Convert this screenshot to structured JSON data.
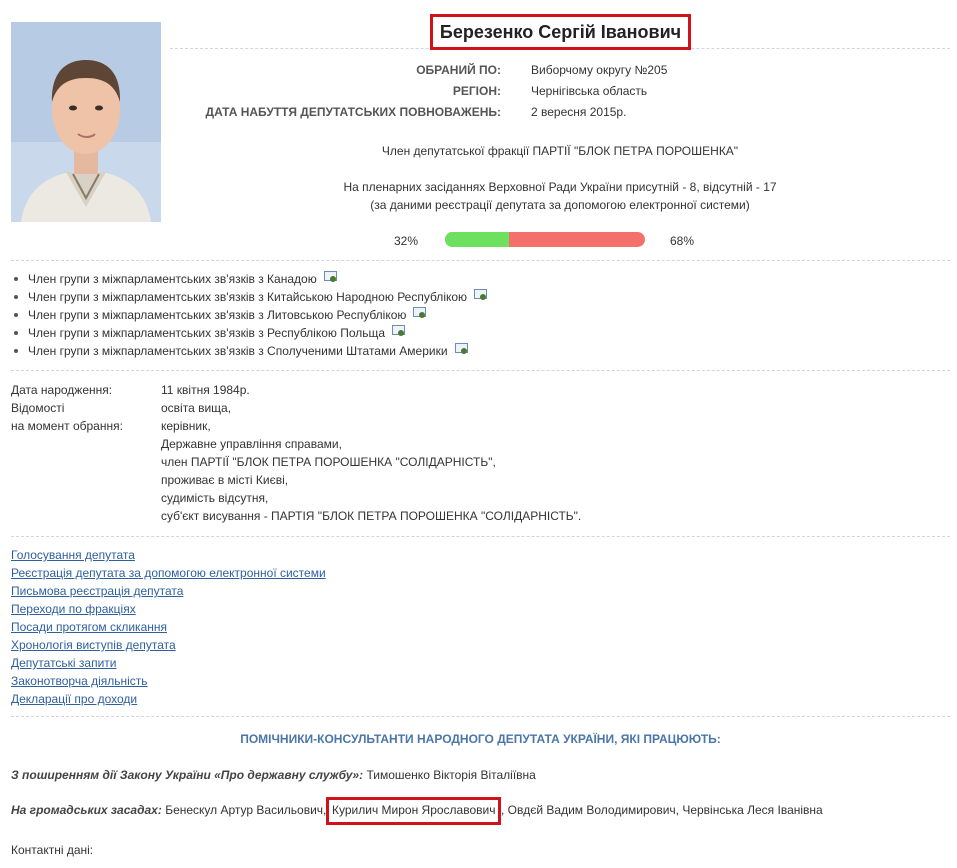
{
  "profile": {
    "name": "Березенко Сергій Іванович",
    "info": [
      {
        "label": "ОБРАНИЙ ПО:",
        "value": "Виборчому округу №205"
      },
      {
        "label": "РЕГІОН:",
        "value": "Чернігівська область"
      },
      {
        "label": "ДАТА НАБУТТЯ ДЕПУТАТСЬКИХ ПОВНОВАЖЕНЬ:",
        "value": "2 вересня 2015р."
      }
    ],
    "faction": "Член депутатської фракції ПАРТІЇ \"БЛОК ПЕТРА ПОРОШЕНКА\"",
    "attendance_line1": "На пленарних засіданнях Верховної Ради України присутній - 8, відсутній - 17",
    "attendance_line2": "(за даними реєстрації депутата за допомогою електронної системи)",
    "attendance": {
      "present_pct": 32,
      "absent_pct": 68,
      "present_label": "32%",
      "absent_label": "68%"
    }
  },
  "groups": [
    "Член групи з міжпарламентських зв'язків з Канадою",
    "Член групи з міжпарламентських зв'язків з Китайською Народною Республікою",
    "Член групи з міжпарламентських зв'язків з Литовською Республікою",
    "Член групи з міжпарламентських зв'язків з Республікою Польща",
    "Член групи з міжпарламентських зв'язків з Сполученими Штатами Америки"
  ],
  "bio": {
    "birth_label": "Дата народження:",
    "birth_value": "11 квітня 1984р.",
    "info_label": "Відомості\nна момент обрання:",
    "info_lines": [
      "освіта вища,",
      "керівник,",
      "Державне управління справами,",
      "член ПАРТІЇ \"БЛОК ПЕТРА ПОРОШЕНКА \"СОЛІДАРНІСТЬ\",",
      "проживає в місті Києві,",
      "судимість відсутня,",
      "суб'єкт висування - ПАРТІЯ \"БЛОК ПЕТРА ПОРОШЕНКА \"СОЛІДАРНІСТЬ\"."
    ]
  },
  "links": [
    "Голосування депутата",
    "Реєстрація депутата за допомогою електронної системи",
    "Письмова реєстрація депутата",
    "Переходи по фракціях",
    "Посади протягом скликання",
    "Хронологія виступів депутата",
    "Депутатські запити",
    "Законотворча діяльність",
    "Декларації про доходи"
  ],
  "assistants": {
    "heading": "ПОМІЧНИКИ-КОНСУЛЬТАНТИ НАРОДНОГО ДЕПУТАТА УКРАЇНИ, ЯКІ ПРАЦЮЮТЬ:",
    "civil_service_label": "З поширенням дії Закону України «Про державну службу»:",
    "civil_service_names": "Тимошенко Вікторія Віталіївна",
    "volunteer_label": "На громадських засадах:",
    "volunteer_before": "Бенескул Артур Васильович,",
    "volunteer_highlight": "Курилич Мирон Ярославович",
    "volunteer_after": ", Овдєй Вадим Володимирович, Червінська Леся Іванівна",
    "contacts_label": "Контактні дані:"
  },
  "colors": {
    "present": "#6ee05f",
    "absent": "#f5706b",
    "highlight": "#d0121b",
    "link": "#2e5f9e"
  }
}
